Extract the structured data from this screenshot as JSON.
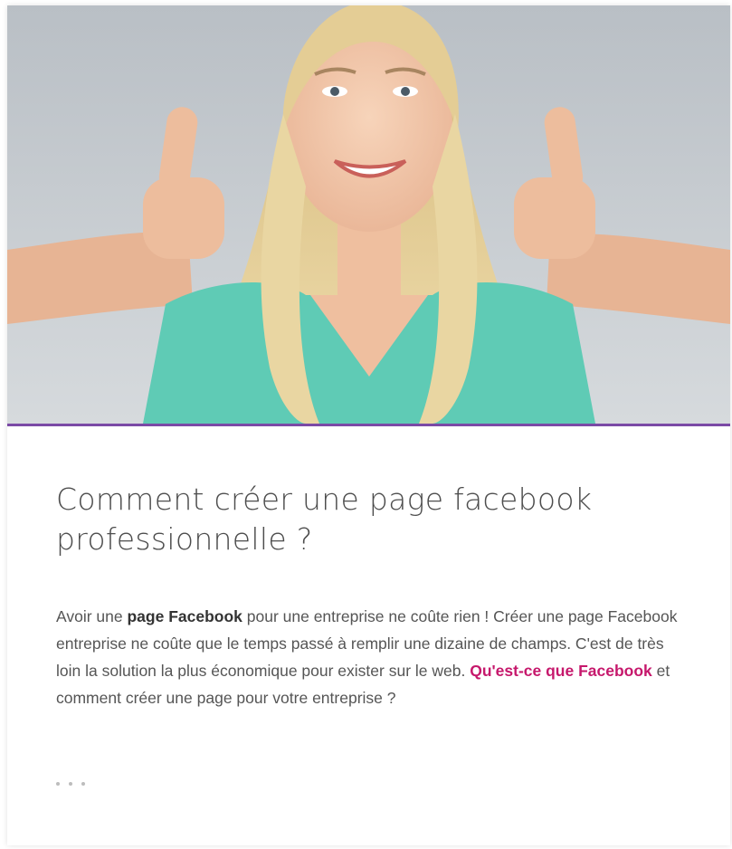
{
  "article": {
    "title": "Comment créer une page facebook professionnelle ?",
    "excerpt": {
      "part1": "Avoir une ",
      "bold1": "page Facebook",
      "part2": " pour une entreprise ne coûte rien ! Créer une page Facebook entreprise ne coûte que le temps passé à remplir une dizaine de champs. C'est de très loin la solution la plus économique pour exister sur le web. ",
      "link": "Qu'est-ce que Facebook",
      "part3": " et comment créer une page pour votre entreprise ?"
    },
    "more_indicator": "read-more-dots"
  },
  "hero_image": {
    "subject": "smiling woman giving two thumbs up",
    "background": "#c9ced2",
    "top_color": "#b6bcc2",
    "shirt_color": "#5fcbb5",
    "hair_color": "#e2cc95",
    "skin_color": "#f0c3a5"
  },
  "colors": {
    "accent": "#c6186c",
    "rule": "#7b4aa6",
    "title": "#4d4d4d",
    "text": "#555555"
  }
}
